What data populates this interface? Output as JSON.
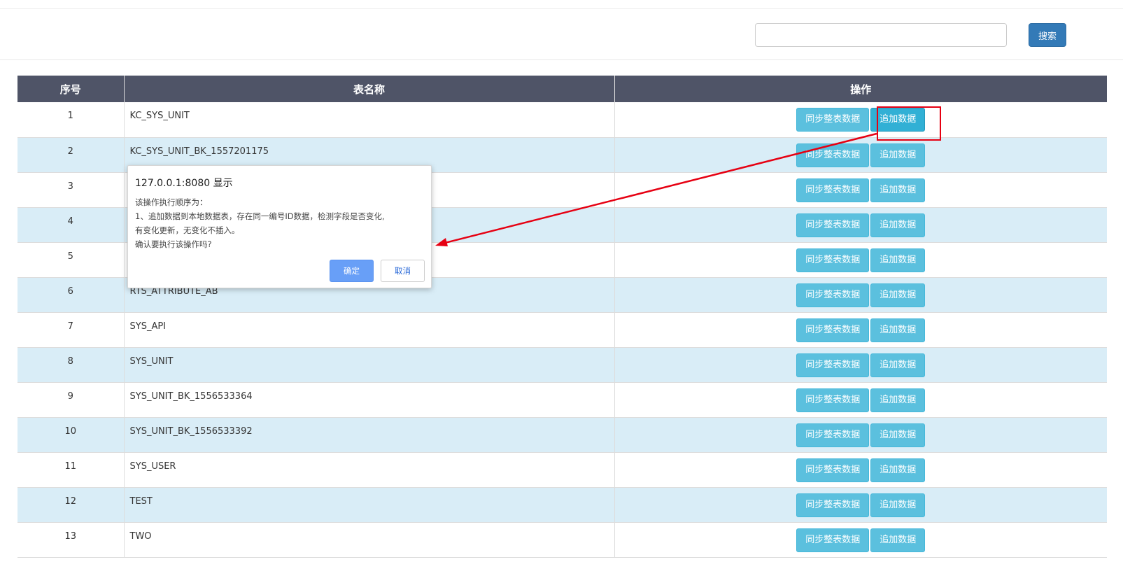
{
  "toolbar": {
    "search_placeholder": "",
    "search_value": "",
    "search_button_label": "搜索"
  },
  "table": {
    "headers": [
      "序号",
      "表名称",
      "操作"
    ],
    "sync_button_label": "同步整表数据",
    "append_button_label": "追加数据",
    "rows": [
      {
        "no": "1",
        "name": "KC_SYS_UNIT"
      },
      {
        "no": "2",
        "name": "KC_SYS_UNIT_BK_1557201175"
      },
      {
        "no": "3",
        "name": ""
      },
      {
        "no": "4",
        "name": ""
      },
      {
        "no": "5",
        "name": ""
      },
      {
        "no": "6",
        "name": "RTS_ATTRIBUTE_AB"
      },
      {
        "no": "7",
        "name": "SYS_API"
      },
      {
        "no": "8",
        "name": "SYS_UNIT"
      },
      {
        "no": "9",
        "name": "SYS_UNIT_BK_1556533364"
      },
      {
        "no": "10",
        "name": "SYS_UNIT_BK_1556533392"
      },
      {
        "no": "11",
        "name": "SYS_USER"
      },
      {
        "no": "12",
        "name": "TEST"
      },
      {
        "no": "13",
        "name": "TWO"
      }
    ]
  },
  "dialog": {
    "title": "127.0.0.1:8080 显示",
    "lines": [
      "该操作执行顺序为：",
      "1、追加数据到本地数据表，存在同一编号ID数据，检测字段是否变化,",
      "有变化更新，无变化不插入。",
      "确认要执行该操作吗?"
    ],
    "ok_label": "确定",
    "cancel_label": "取消"
  },
  "colors": {
    "header_bg": "#4f5467",
    "stripe_bg": "#d9edf7",
    "info_button": "#5bc0de",
    "primary_button": "#337ab7",
    "annotation_red": "#e60012",
    "dialog_ok": "#689ff7"
  }
}
